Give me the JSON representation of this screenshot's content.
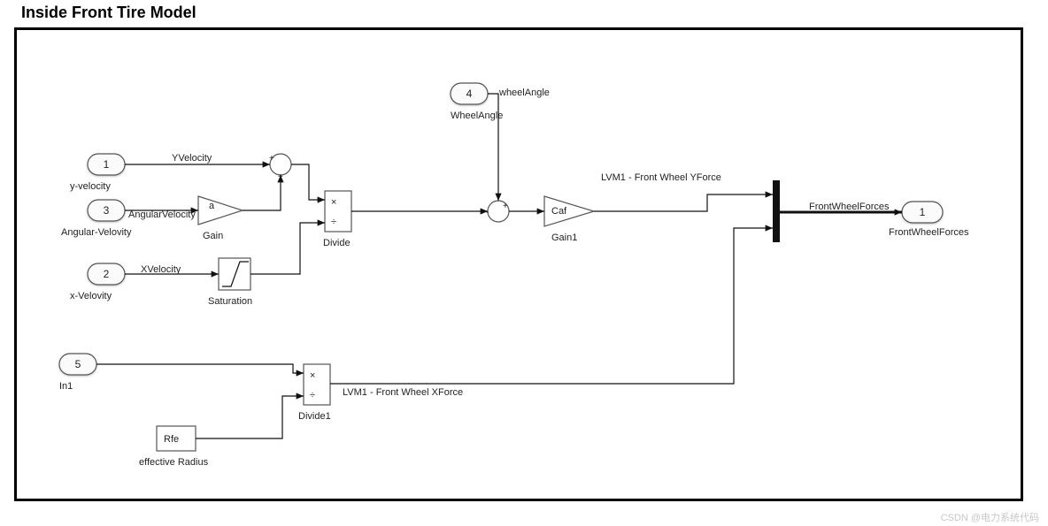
{
  "title": "Inside Front Tire Model",
  "watermark": "CSDN @电力系统代码",
  "blocks": {
    "inport_yvel": {
      "num": "1",
      "label": "y-velocity",
      "signal": "YVelocity"
    },
    "inport_angvel": {
      "num": "3",
      "label": "Angular-Velovity",
      "signal": "AngularVelocity"
    },
    "inport_xvel": {
      "num": "2",
      "label": "x-Velovity",
      "signal": "XVelocity"
    },
    "inport_wheel": {
      "num": "4",
      "label": "WheelAngle",
      "signal": "wheelAngle"
    },
    "inport_in1": {
      "num": "5",
      "label": "In1"
    },
    "gain": {
      "text": "a",
      "label": "Gain"
    },
    "saturation": {
      "label": "Saturation"
    },
    "divide": {
      "symbols_top": "×",
      "symbols_bot": "÷",
      "label": "Divide"
    },
    "gain1": {
      "text": "Caf",
      "label": "Gain1"
    },
    "sig_yforce": "LVM1 - Front Wheel YForce",
    "divide1": {
      "symbols_top": "×",
      "symbols_bot": "÷",
      "label": "Divide1"
    },
    "sig_xforce": "LVM1 - Front Wheel XForce",
    "const_rfe": {
      "text": "Rfe",
      "label": "effective Radius"
    },
    "mux_out": "FrontWheelForces",
    "outport": {
      "num": "1",
      "label": "FrontWheelForces"
    }
  }
}
